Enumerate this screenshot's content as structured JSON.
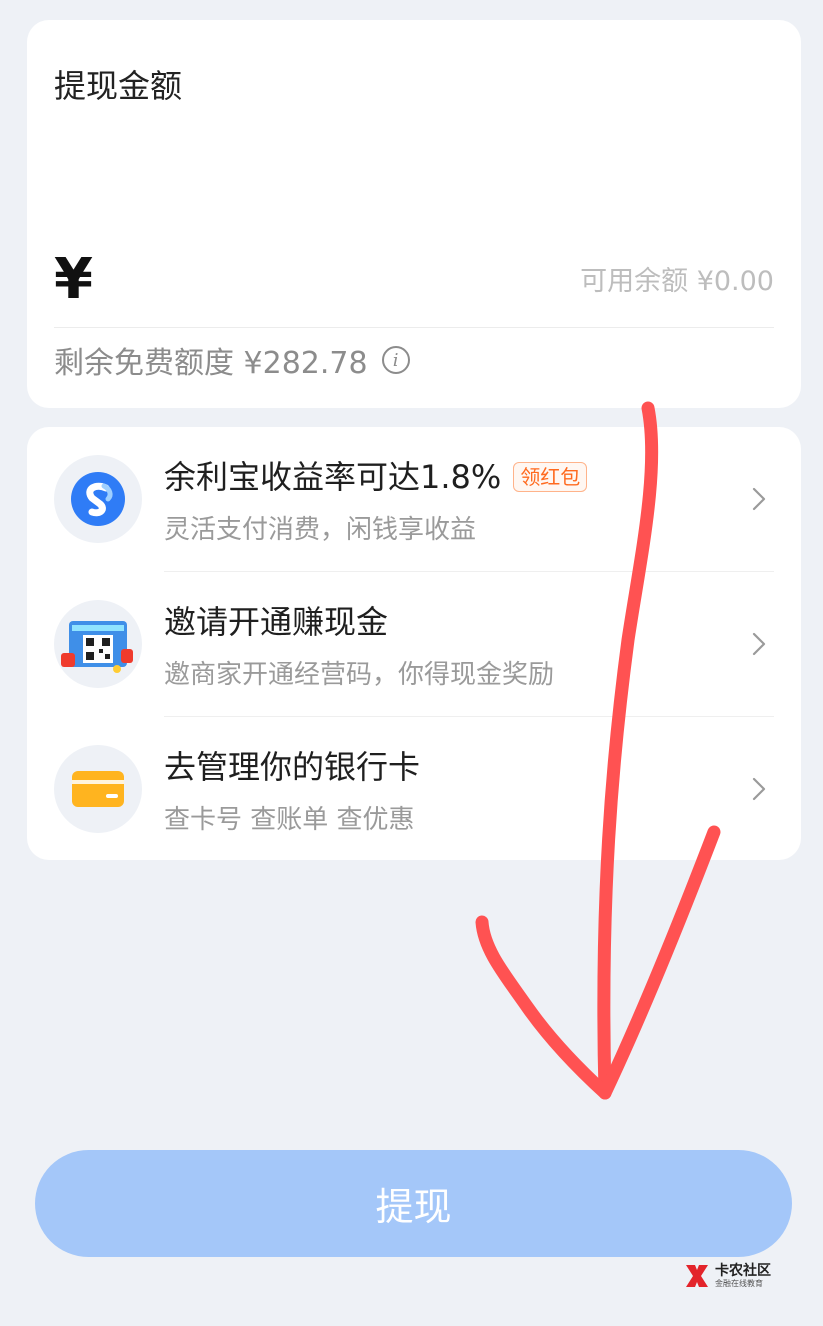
{
  "amount_card": {
    "title": "提现金额",
    "currency_symbol": "¥",
    "available_label": "可用余额 ¥0.00",
    "free_quota_label": "剩余免费额度 ¥282.78",
    "info_glyph": "i"
  },
  "services": [
    {
      "title": "余利宝收益率可达1.8%",
      "badge": "领红包",
      "subtitle": "灵活支付消费，闲钱享收益",
      "icon": "yulibao-logo-icon"
    },
    {
      "title": "邀请开通赚现金",
      "subtitle": "邀商家开通经营码，你得现金奖励",
      "icon": "qr-invite-icon"
    },
    {
      "title": "去管理你的银行卡",
      "subtitle": "查卡号 查账单 查优惠",
      "icon": "bank-card-icon"
    }
  ],
  "submit": {
    "label": "提现"
  },
  "watermark": {
    "main": "卡农社区",
    "sub": "金融在线教育"
  },
  "colors": {
    "background": "#eef1f6",
    "button": "#a4c7f9",
    "badge": "#ff6a1f",
    "annotation_arrow": "#ff5252"
  }
}
